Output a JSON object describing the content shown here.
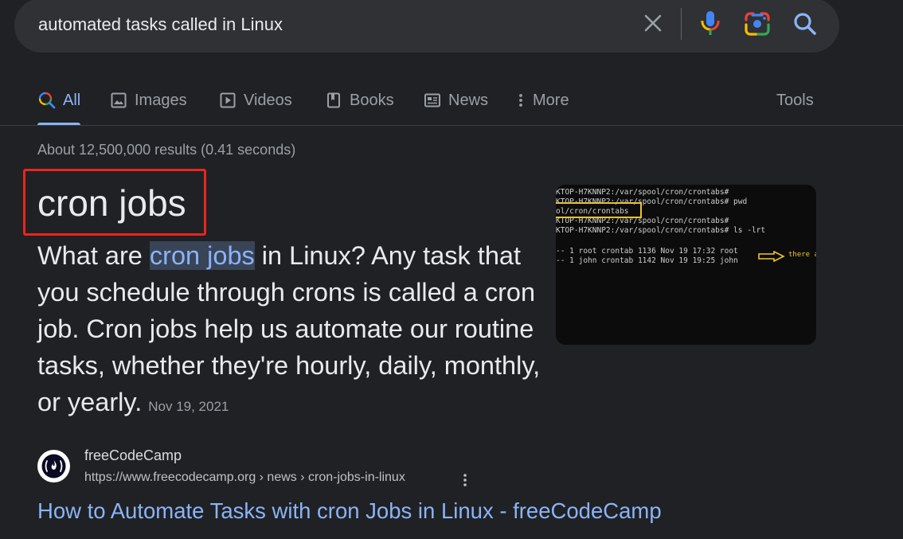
{
  "search": {
    "query": "automated tasks called in Linux"
  },
  "tabs": [
    {
      "label": "All",
      "icon": "search-icon",
      "active": true
    },
    {
      "label": "Images",
      "icon": "image-icon"
    },
    {
      "label": "Videos",
      "icon": "play-icon"
    },
    {
      "label": "Books",
      "icon": "book-icon"
    },
    {
      "label": "News",
      "icon": "newspaper-icon"
    },
    {
      "label": "More",
      "icon": "more-vert-icon"
    }
  ],
  "tools_label": "Tools",
  "result_stats": "About 12,500,000 results (0.41 seconds)",
  "featured": {
    "answer": "cron jobs",
    "snippet_before": "What are ",
    "snippet_highlight": "cron jobs",
    "snippet_after": " in Linux? Any task that you schedule through crons is called a cron job. Cron jobs help us automate our routine tasks, whether they're hourly, daily, monthly, or yearly.",
    "date": "Nov 19, 2021",
    "thumbnail": {
      "lines": [
        "KTOP-H7KNNP2:/var/spool/cron/crontabs#",
        "KTOP-H7KNNP2:/var/spool/cron/crontabs# pwd",
        "ol/cron/crontabs",
        "KTOP-H7KNNP2:/var/spool/cron/crontabs#",
        "KTOP-H7KNNP2:/var/spool/cron/crontabs# ls -lrt",
        "-- 1 root crontab 1136 Nov 19 17:32 root",
        "-- 1 john crontab 1142 Nov 19 19:25 john"
      ],
      "note": "there a"
    }
  },
  "source": {
    "name": "freeCodeCamp",
    "url": "https://www.freecodecamp.org › news › cron-jobs-in-linux",
    "favicon_glyph": "(🔥)",
    "title": "How to Automate Tasks with cron Jobs in Linux - freeCodeCamp"
  },
  "colors": {
    "background": "#202124",
    "search_bar": "#303134",
    "link": "#8ab4f8",
    "highlight_border": "#e8261f",
    "terminal_accent": "#e6c530"
  }
}
